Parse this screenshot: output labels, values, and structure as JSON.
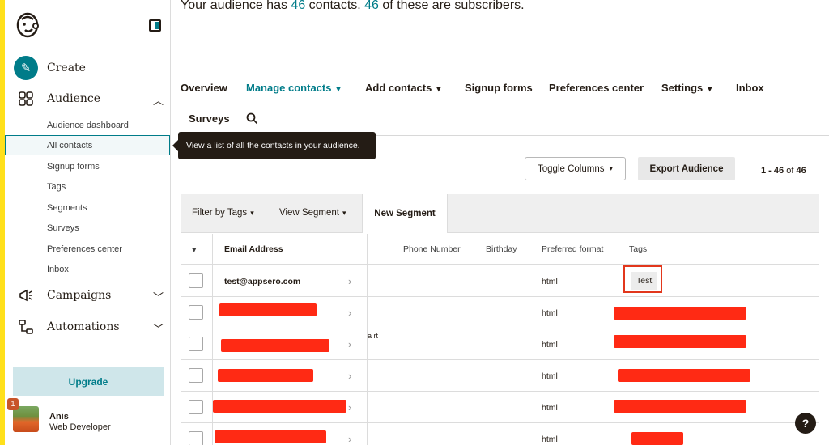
{
  "headline": {
    "prefix": "Your audience has",
    "count": "46",
    "middle": "contacts.",
    "subs": "46",
    "suffix": "of these are subscribers."
  },
  "sidebar": {
    "main": [
      {
        "label": "Create",
        "icon": "pencil-icon"
      },
      {
        "label": "Audience",
        "icon": "audience-icon",
        "expanded": true
      },
      {
        "label": "Campaigns",
        "icon": "megaphone-icon"
      },
      {
        "label": "Automations",
        "icon": "automation-icon"
      }
    ],
    "audience_sub": [
      "Audience dashboard",
      "All contacts",
      "Signup forms",
      "Tags",
      "Segments",
      "Surveys",
      "Preferences center",
      "Inbox"
    ],
    "active_sub": "All contacts",
    "upgrade_label": "Upgrade",
    "notification_count": "1",
    "user": {
      "name": "Anis",
      "role": "Web Developer"
    }
  },
  "tooltip": "View a list of all the contacts in your audience.",
  "tabs": [
    {
      "label": "Overview"
    },
    {
      "label": "Manage contacts",
      "active": true,
      "dropdown": true
    },
    {
      "label": "Add contacts",
      "dropdown": true
    },
    {
      "label": "Signup forms"
    },
    {
      "label": "Preferences center"
    },
    {
      "label": "Settings",
      "dropdown": true
    },
    {
      "label": "Inbox"
    },
    {
      "label": "Surveys"
    }
  ],
  "toolbar": {
    "toggle_columns": "Toggle Columns",
    "export": "Export Audience",
    "pager_range": "1 - 46",
    "pager_of": "of",
    "pager_total": "46"
  },
  "filters": {
    "filter_by_tags": "Filter by Tags",
    "view_segment": "View Segment",
    "new_segment": "New Segment"
  },
  "table": {
    "headers": {
      "email": "Email Address",
      "phone": "Phone Number",
      "birthday": "Birthday",
      "format": "Preferred format",
      "tags": "Tags"
    },
    "rows": [
      {
        "email": "test@appsero.com",
        "format": "html",
        "tag": "Test"
      },
      {
        "email": "",
        "format": "html",
        "tag": ""
      },
      {
        "email": "",
        "format": "html",
        "tag": "",
        "extra": "a rt"
      },
      {
        "email": "",
        "format": "html",
        "tag": ""
      },
      {
        "email": "",
        "format": "html",
        "tag": ""
      },
      {
        "email": "",
        "format": "html",
        "tag": ""
      }
    ]
  },
  "colors": {
    "accent": "#007c89",
    "brand_yellow": "#ffe01b",
    "redaction": "#ff2a14",
    "text": "#241c15"
  },
  "help_label": "?"
}
